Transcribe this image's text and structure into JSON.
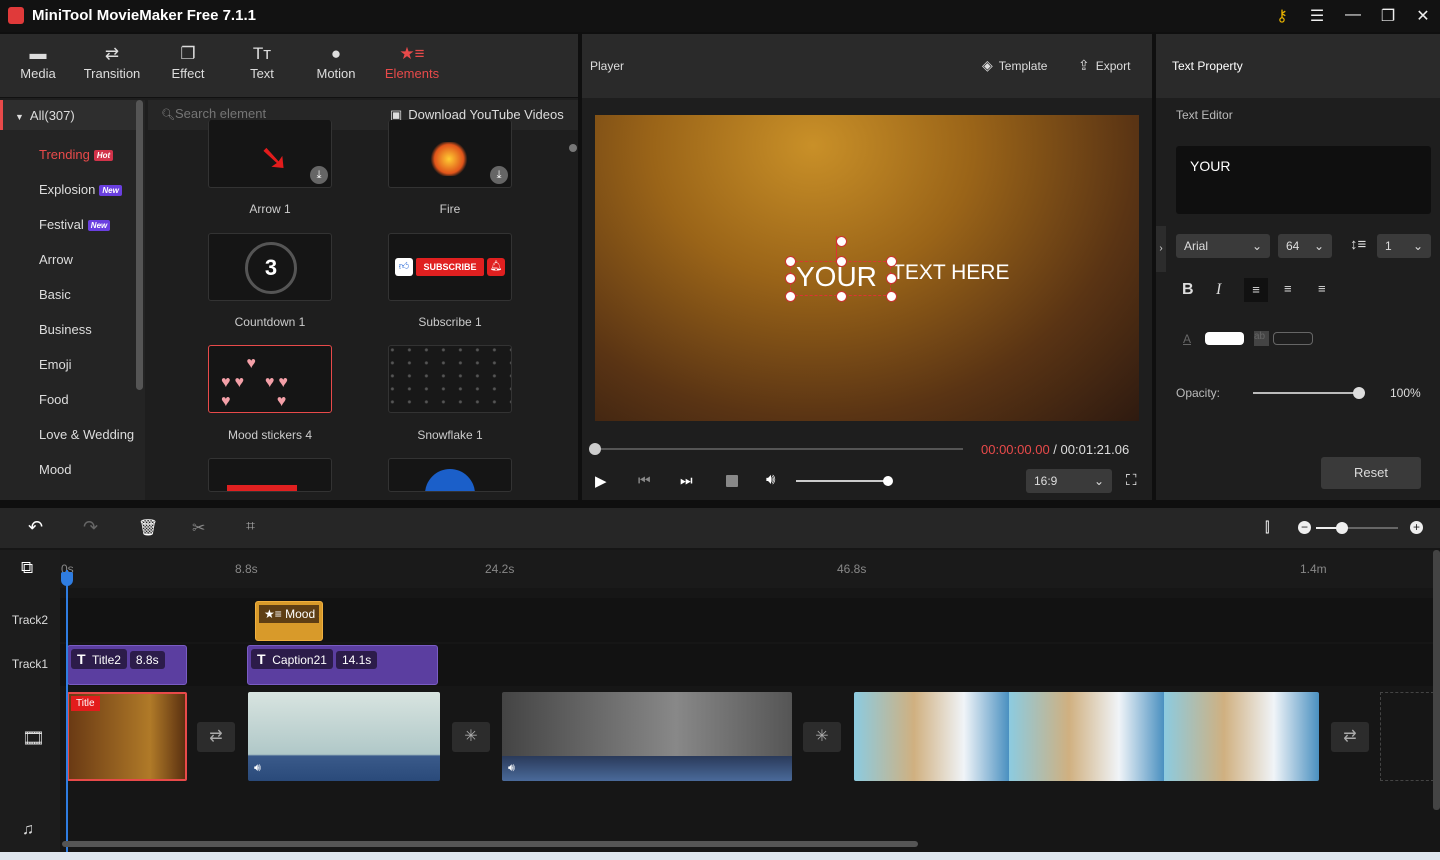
{
  "app": {
    "title": "MiniTool MovieMaker Free 7.1.1"
  },
  "toolbar": {
    "tabs": [
      {
        "label": "Media",
        "icon": "folder-icon"
      },
      {
        "label": "Transition",
        "icon": "swap-icon"
      },
      {
        "label": "Effect",
        "icon": "effect-icon"
      },
      {
        "label": "Text",
        "icon": "text-icon"
      },
      {
        "label": "Motion",
        "icon": "motion-icon"
      },
      {
        "label": "Elements",
        "icon": "elements-icon",
        "active": true
      }
    ]
  },
  "sidebar": {
    "all": "All(307)",
    "items": [
      {
        "label": "Trending",
        "badge": "Hot"
      },
      {
        "label": "Explosion",
        "badge": "New"
      },
      {
        "label": "Festival",
        "badge": "New"
      },
      {
        "label": "Arrow"
      },
      {
        "label": "Basic"
      },
      {
        "label": "Business"
      },
      {
        "label": "Emoji"
      },
      {
        "label": "Food"
      },
      {
        "label": "Love & Wedding"
      },
      {
        "label": "Mood"
      }
    ]
  },
  "library": {
    "search_placeholder": "Search element",
    "download_label": "Download YouTube Videos",
    "items": [
      "Arrow 1",
      "Fire",
      "Countdown 1",
      "Subscribe 1",
      "Mood stickers 4",
      "Snowflake 1"
    ],
    "countdown_digit": "3",
    "subscribe_text": "SUBSCRIBE"
  },
  "player": {
    "title": "Player",
    "template_label": "Template",
    "export_label": "Export",
    "overlay_text_1": "YOUR",
    "overlay_text_2": "TEXT HERE",
    "current_time": "00:00:00.00",
    "separator": " / ",
    "total_time": "00:01:21.06",
    "aspect": "16:9",
    "progress": 0,
    "volume": 0.8
  },
  "text_property": {
    "title": "Text Property",
    "editor_label": "Text Editor",
    "text": "YOUR",
    "font": "Arial",
    "size": "64",
    "line_spacing": "1",
    "opacity_label": "Opacity:",
    "opacity_value": "100%",
    "reset_label": "Reset",
    "colors": {
      "text": "#ffffff"
    }
  },
  "timeline": {
    "ticks": [
      "0s",
      "8.8s",
      "24.2s",
      "46.8s",
      "1.4m"
    ],
    "tracks": [
      "Track2",
      "Track1"
    ],
    "element_clip": "Mood s",
    "text_clips": [
      {
        "name": "Title2",
        "duration": "8.8s"
      },
      {
        "name": "Caption21",
        "duration": "14.1s"
      }
    ],
    "title_badge": "Title"
  },
  "colors": {
    "accent": "#e84a4a",
    "playhead": "#2f7de1",
    "text_clip": "#5b3ea0",
    "element_clip": "#d89a2a"
  }
}
